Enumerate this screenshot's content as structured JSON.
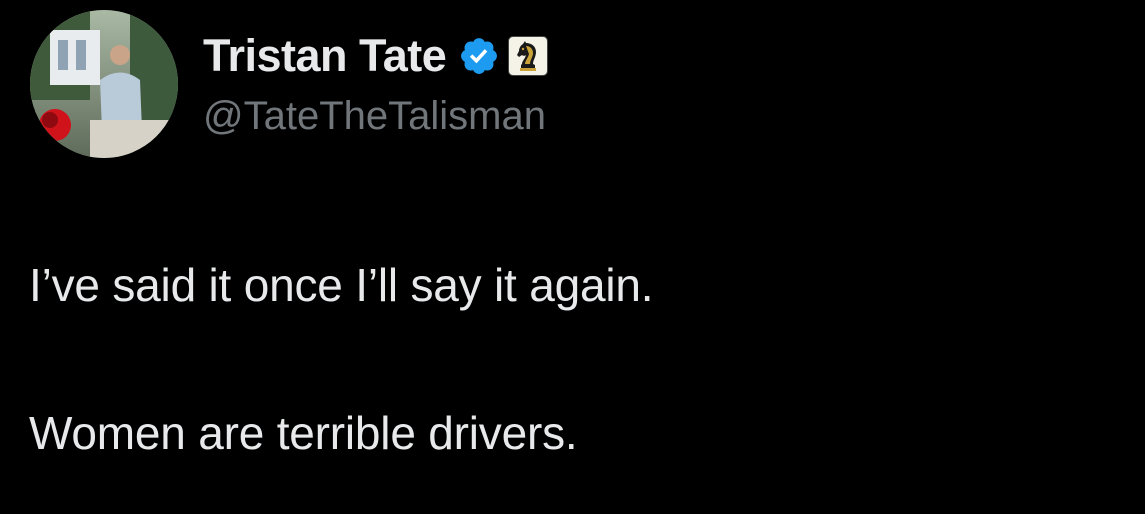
{
  "author": {
    "display_name": "Tristan Tate",
    "handle": "@TateTheTalisman",
    "avatar_icon": "profile-photo",
    "verified_icon": "verified-badge-icon",
    "affiliate_icon": "knight-chess-piece-icon",
    "verified_color": "#1d9bf0"
  },
  "tweet": {
    "lines": [
      "I’ve said it once I’ll say it again.",
      "Women are terrible drivers."
    ]
  },
  "colors": {
    "background": "#000000",
    "primary_text": "#e7e9ea",
    "secondary_text": "#71767b"
  }
}
